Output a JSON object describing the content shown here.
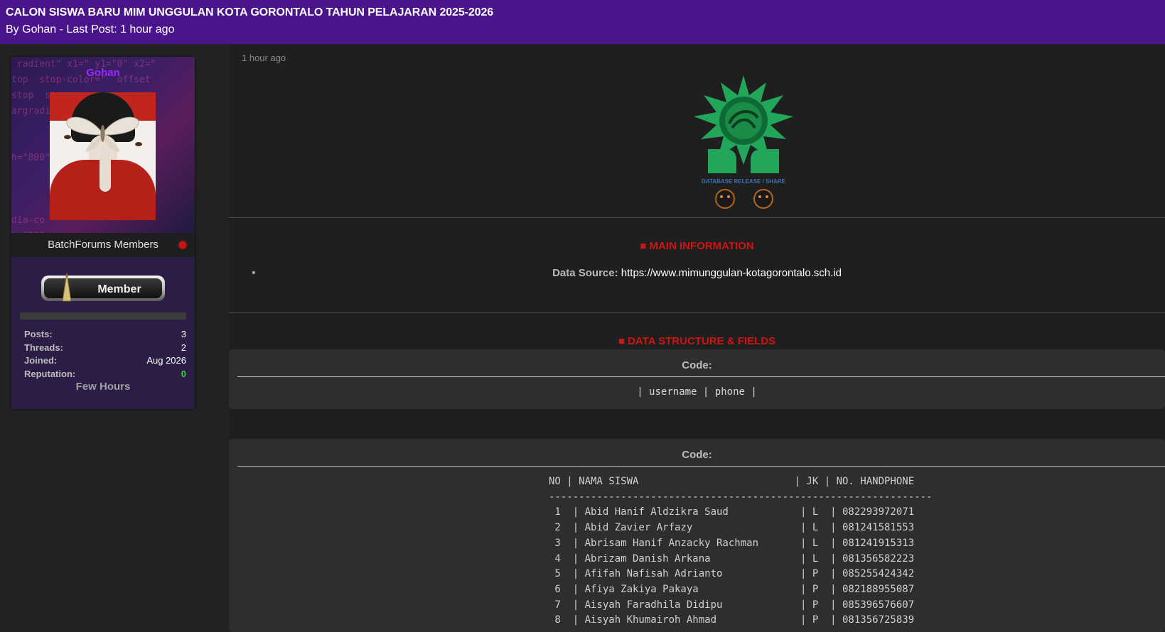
{
  "thread": {
    "title": "CALON SISWA BARU MIM UNGGULAN KOTA GORONTALO TAHUN PELAJARAN 2025-2026",
    "byline": "By Gohan - Last Post: 1 hour ago"
  },
  "user": {
    "username": "Gohan",
    "group": "BatchForums Members",
    "rank": "Member",
    "stats": [
      {
        "label": "Posts:",
        "value": "3"
      },
      {
        "label": "Threads:",
        "value": "2"
      },
      {
        "label": "Joined:",
        "value": "Aug 2026"
      },
      {
        "label": "Reputation:",
        "value": "0"
      }
    ],
    "time_online": "Few Hours",
    "status_color": "#d11010",
    "name_color": "#9c27ff"
  },
  "post": {
    "date": "1 hour ago",
    "logo_caption": "DATABASE RELEASE / SHARE",
    "main_info_title": "■ MAIN INFORMATION",
    "data_source_label": "Data Source:",
    "data_source_url": "https://www.mimunggulan-kotagorontalo.sch.id",
    "structure_title": "■ DATA STRUCTURE & FIELDS",
    "code_label": "Code:",
    "fields_code": "| username | phone |",
    "table_code": "NO | NAMA SISWA                          | JK | NO. HANDPHONE\n----------------------------------------------------------------\n 1  | Abid Hanif Aldzikra Saud            | L  | 082293972071\n 2  | Abid Zavier Arfazy                  | L  | 081241581553\n 3  | Abrisam Hanif Anzacky Rachman       | L  | 081241915313\n 4  | Abrizam Danish Arkana               | L  | 081356582223\n 5  | Afifah Nafisah Adrianto             | P  | 085255424342\n 6  | Afiya Zakiya Pakaya                 | P  | 082188955087\n 7  | Aisyah Faradhila Didipu             | P  | 085396576607\n 8  | Aisyah Khumairoh Ahmad              | P  | 081356725839",
    "accent_color": "#d01414"
  }
}
